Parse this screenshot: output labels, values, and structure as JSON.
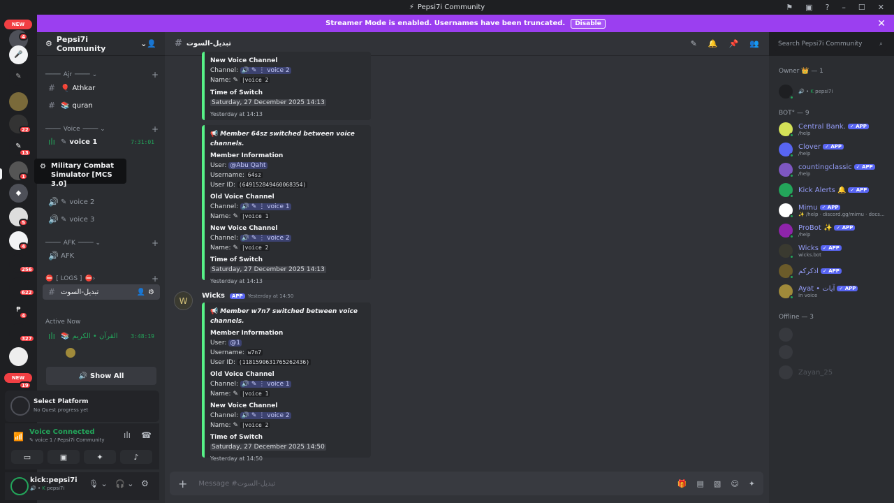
{
  "window": {
    "title": "Pepsi7i Community"
  },
  "banner": {
    "text": "Streamer Mode is enabled. Usernames have been truncated.",
    "button": "Disable"
  },
  "servers": {
    "new_top": "NEW",
    "new_bottom": "NEW",
    "badges": [
      "4",
      "22",
      "13",
      "1",
      "5",
      "4",
      "256",
      "622",
      "4",
      "327",
      "19"
    ]
  },
  "tooltip": {
    "text": "Military Combat Simulator [MCS 3.0]"
  },
  "sidebar": {
    "server_name": "Pepsi7i Community",
    "cat_ajr": "Ajr",
    "athkar": "Athkar",
    "quran": "quran",
    "cat_voice": "Voice",
    "voice1": "voice 1",
    "voice1_time": "7:31:01",
    "voice2": "voice 2",
    "voice3": "voice 3",
    "cat_afk": "AFK",
    "afk": "AFK",
    "cat_logs": "[ LOGS ]",
    "logs_channel": "تبديل-السوت",
    "active_now": "Active Now",
    "active_channel": "القرآن • الكريم",
    "active_time": "3:48:19",
    "show_all": "Show All"
  },
  "platform": {
    "title": "Select Platform",
    "subtitle": "No Quest progress yet"
  },
  "voice_connected": {
    "title": "Voice Connected",
    "subtitle": "voice 1 / Pepsi7i Community"
  },
  "user": {
    "name": "kick:pepsi7i",
    "status": "pepsi7i"
  },
  "chat": {
    "channel_name": "تبديل-السوت",
    "search_placeholder": "Search Pepsi7i Community",
    "input_placeholder": "Message #تبديل-السوت",
    "embed1": {
      "new_voice_label": "New Voice Channel",
      "channel_label": "Channel:",
      "channel_value": "voice 2",
      "name_label": "Name:",
      "name_value": "|voice 2",
      "time_label": "Time of Switch",
      "time_value": "Saturday, 27 December 2025 14:13",
      "footer": "Yesterday at 14:13"
    },
    "embed2": {
      "title": "Member 64sz switched between voice channels.",
      "info_label": "Member Information",
      "user_label": "User:",
      "user_value": "@Abu Qaht",
      "username_label": "Username:",
      "username_value": "64sz",
      "userid_label": "User ID:",
      "userid_value": "(649152849460068354)",
      "old_label": "Old Voice Channel",
      "old_channel": "voice 1",
      "old_name": "|voice 1",
      "new_label": "New Voice Channel",
      "new_channel": "voice 2",
      "new_name": "|voice 2",
      "time_label": "Time of Switch",
      "time_value": "Saturday, 27 December 2025 14:13",
      "footer": "Yesterday at 14:13"
    },
    "message3": {
      "author": "Wicks",
      "tag": "APP",
      "timestamp": "Yesterday at 14:50"
    },
    "embed3": {
      "title": "Member w7n7 switched between voice channels.",
      "info_label": "Member Information",
      "user_label": "User:",
      "user_value": "@1",
      "username_label": "Username:",
      "username_value": "w7n7",
      "userid_label": "User ID:",
      "userid_value": "(1181590631765262436)",
      "old_label": "Old Voice Channel",
      "old_channel": "voice 1",
      "old_name": "|voice 1",
      "new_label": "New Voice Channel",
      "new_channel": "voice 2",
      "new_name": "|voice 2",
      "time_label": "Time of Switch",
      "time_value": "Saturday, 27 December 2025 14:50",
      "footer": "Yesterday at 14:50"
    }
  },
  "members": {
    "owner_header": "Owner 👑 — 1",
    "owner_name": "pepsi7i",
    "bot_header": "BOT° — 9",
    "bots": [
      {
        "name": "Central Bank.",
        "tag": "✓ APP",
        "sub": "/help"
      },
      {
        "name": "Clover",
        "tag": "✓ APP",
        "sub": "/help"
      },
      {
        "name": "countingclassic",
        "tag": "✓ APP",
        "sub": "/help"
      },
      {
        "name": "Kick Alerts 🔔",
        "tag": "✓ APP",
        "sub": ""
      },
      {
        "name": "Mimu",
        "tag": "✓ APP",
        "sub": "✨ /help · discord.gg/mimu · docs..."
      },
      {
        "name": "ProBot ✨",
        "tag": "✓ APP",
        "sub": "/help"
      },
      {
        "name": "Wicks",
        "tag": "✓ APP",
        "sub": "wicks.bot"
      },
      {
        "name": "اذكركم",
        "tag": "✓ APP",
        "sub": ""
      },
      {
        "name": "Ayat • آيات",
        "tag": "✓ APP",
        "sub": "In voice"
      }
    ],
    "offline_header": "Offline — 3",
    "offline_name": "Zayan_25"
  },
  "colors": {
    "accent": "#5865f2",
    "banner": "#9b3ff0",
    "online": "#23a55a",
    "embed_border": "#57f287"
  }
}
